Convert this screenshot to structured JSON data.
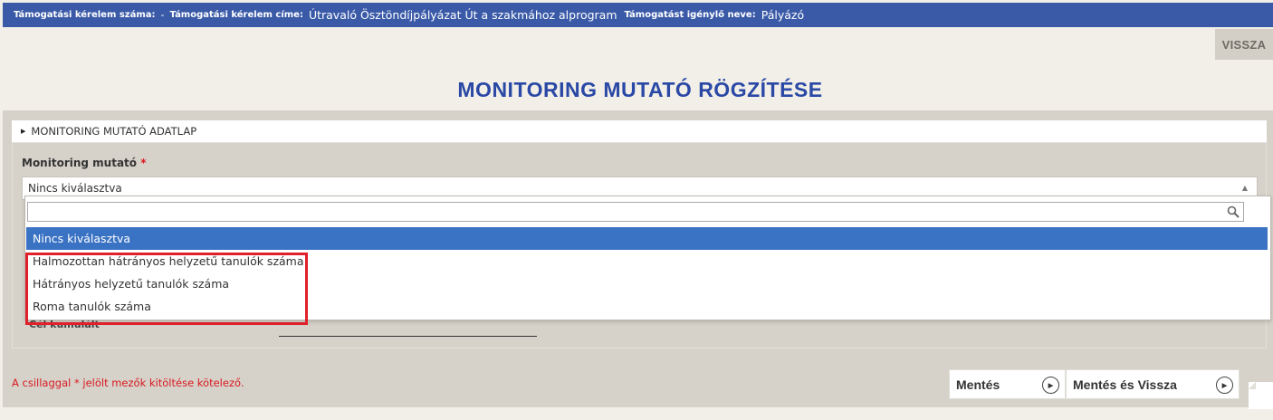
{
  "topbar": {
    "request_number_label": "Támogatási kérelem száma:",
    "request_number_value": "-",
    "request_title_label": "Támogatási kérelem címe:",
    "request_title_value": "Útravaló Ösztöndíjpályázat Út a szakmához alprogram",
    "applicant_label": "Támogatást igénylő neve:",
    "applicant_value": "Pályázó"
  },
  "back_button": "VISSZA",
  "page_title": "MONITORING MUTATÓ RÖGZÍTÉSE",
  "section": {
    "title": "MONITORING MUTATÓ ADATLAP"
  },
  "field": {
    "label": "Monitoring mutató",
    "required_mark": "*",
    "selected_value": "Nincs kiválasztva"
  },
  "dropdown": {
    "search_value": "",
    "options": [
      "Nincs kiválasztva",
      "Halmozottan hátrányos helyzetű tanulók száma",
      "Hátrányos helyzetű tanulók száma",
      "Roma tanulók száma"
    ],
    "selected_index": 0
  },
  "obscured_label": "Cél kumulált",
  "required_note": "A csillaggal * jelölt mezők kitöltése kötelező.",
  "buttons": {
    "save": "Mentés",
    "save_and_back": "Mentés és Vissza"
  },
  "colors": {
    "topbar": "#3a5aa8",
    "title": "#2a48a5",
    "selected_option": "#3a72c4",
    "highlight": "#e0202b"
  }
}
